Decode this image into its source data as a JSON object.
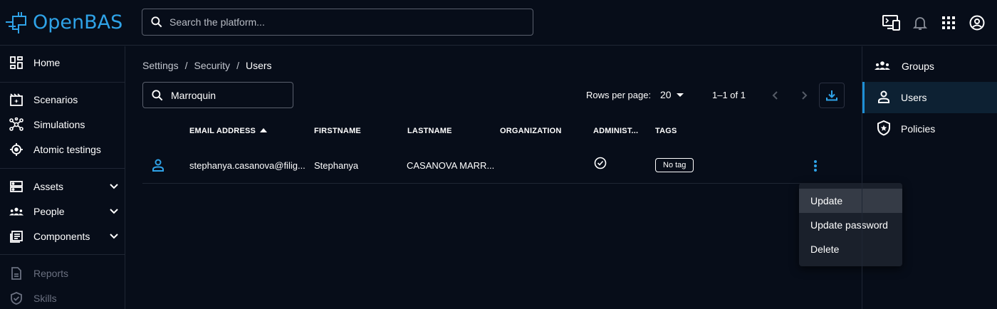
{
  "app": {
    "name": "OpenBAS"
  },
  "search": {
    "placeholder": "Search the platform..."
  },
  "topbar_icons": [
    "screen-preview-icon",
    "bell-icon",
    "apps-grid-icon",
    "account-circle-icon"
  ],
  "leftnav": {
    "items": [
      {
        "label": "Home",
        "icon": "dashboard-icon"
      },
      {
        "label": "Scenarios",
        "icon": "movie-filter-icon"
      },
      {
        "label": "Simulations",
        "icon": "hub-icon"
      },
      {
        "label": "Atomic testings",
        "icon": "crosshair-icon"
      },
      {
        "label": "Assets",
        "icon": "dns-icon",
        "expandable": true
      },
      {
        "label": "People",
        "icon": "groups-icon",
        "expandable": true
      },
      {
        "label": "Components",
        "icon": "newspaper-icon",
        "expandable": true
      },
      {
        "label": "Reports",
        "icon": "description-icon",
        "disabled": true
      },
      {
        "label": "Skills",
        "icon": "verified-shield-icon",
        "disabled": true
      }
    ]
  },
  "breadcrumb": {
    "items": [
      "Settings",
      "Security",
      "Users"
    ]
  },
  "filter": {
    "value": "Marroquin"
  },
  "pagination": {
    "rows_label": "Rows per page:",
    "rows_value": "20",
    "range": "1–1 of 1"
  },
  "table": {
    "columns": [
      "EMAIL ADDRESS",
      "FIRSTNAME",
      "LASTNAME",
      "ORGANIZATION",
      "ADMINIST...",
      "TAGS"
    ],
    "sort_column": "EMAIL ADDRESS",
    "rows": [
      {
        "email": "stephanya.casanova@filig...",
        "firstname": "Stephanya",
        "lastname": "CASANOVA MARR...",
        "organization": "",
        "admin": true,
        "tag": "No tag"
      }
    ]
  },
  "context_menu": {
    "items": [
      "Update",
      "Update password",
      "Delete"
    ],
    "hovered": "Update"
  },
  "rightnav": {
    "items": [
      {
        "label": "Groups",
        "icon": "groups-icon"
      },
      {
        "label": "Users",
        "icon": "person-icon",
        "active": true
      },
      {
        "label": "Policies",
        "icon": "policy-shield-icon"
      }
    ]
  },
  "colors": {
    "background": "#070d19",
    "accent": "#2fa3e8",
    "active_nav": "#0d2133",
    "menu_bg": "#1a202b"
  }
}
